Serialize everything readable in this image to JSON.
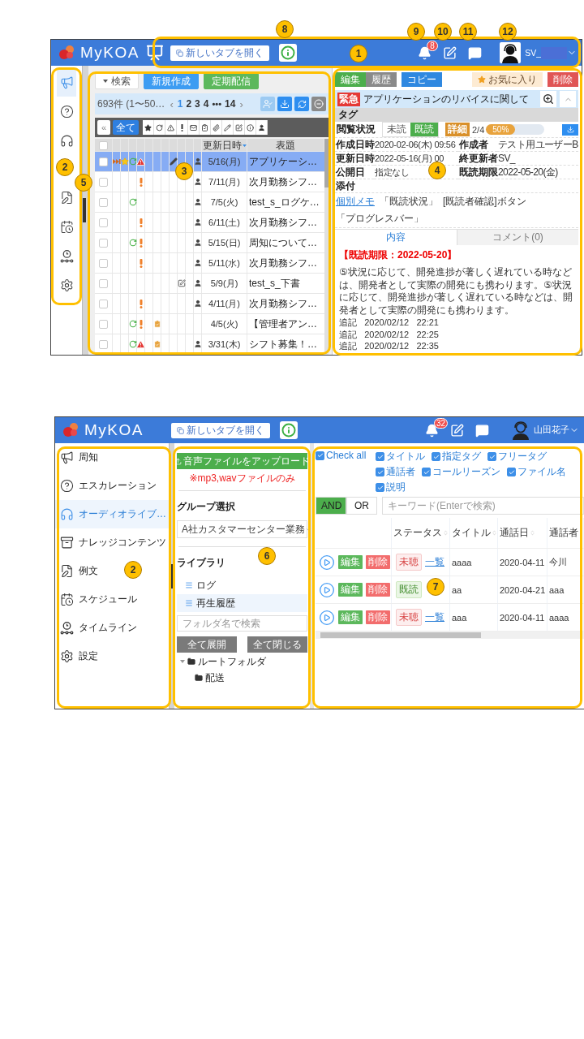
{
  "top_screen": {
    "header": {
      "logo": "MyKOA",
      "new_tab_button": "新しいタブを開く",
      "notification_count": "8",
      "user_name": "SV_"
    },
    "sidebar": [
      {
        "kind": "megaphone",
        "selected": true
      },
      {
        "kind": "question",
        "selected": false
      },
      {
        "kind": "audio",
        "selected": false
      },
      {
        "kind": "document",
        "selected": false
      },
      {
        "kind": "calendar",
        "selected": false
      },
      {
        "kind": "timeline",
        "selected": false
      },
      {
        "kind": "settings",
        "selected": false
      }
    ],
    "toolbar": {
      "search_button": "検索",
      "create_button": "新規作成",
      "schedule_button": "定期配信"
    },
    "pagination": {
      "summary": "693件 (1〜50…",
      "prev": "‹",
      "pages": [
        {
          "label": "1",
          "selected": true
        },
        {
          "label": "2",
          "selected": false
        },
        {
          "label": "3",
          "selected": false
        },
        {
          "label": "4",
          "selected": false
        }
      ],
      "ellipsis": "•••",
      "last_page": {
        "label": "14",
        "selected": false
      },
      "next": "›"
    },
    "filter": {
      "collapse_button": "«",
      "all_button": "全て"
    },
    "table": {
      "header_checked": false,
      "columns": [
        "更新日時",
        "表題"
      ],
      "rows": [
        {
          "selected": true,
          "checked": false,
          "marks": [
            {
              "kind": "forward"
            },
            {
              "kind": "star"
            },
            {
              "kind": "refresh"
            },
            {
              "kind": "warning"
            },
            {
              "kind": "pencil"
            },
            {
              "kind": "person"
            }
          ],
          "date": "5/16(月)",
          "title": "アプリケーシ…"
        },
        {
          "selected": false,
          "checked": false,
          "marks": [
            {
              "kind": "exclaim"
            },
            {
              "kind": "person"
            }
          ],
          "date": "7/11(月)",
          "title": "次月勤務シフ…"
        },
        {
          "selected": false,
          "checked": false,
          "marks": [
            {
              "kind": "refresh"
            },
            {
              "kind": "person"
            }
          ],
          "date": "7/5(火)",
          "title": "test_s_ログケ…"
        },
        {
          "selected": false,
          "checked": false,
          "marks": [
            {
              "kind": "exclaim"
            },
            {
              "kind": "person"
            }
          ],
          "date": "6/11(土)",
          "title": "次月勤務シフ…"
        },
        {
          "selected": false,
          "checked": false,
          "marks": [
            {
              "kind": "refresh"
            },
            {
              "kind": "exclaim"
            },
            {
              "kind": "person"
            }
          ],
          "date": "5/15(日)",
          "title": "周知について…"
        },
        {
          "selected": false,
          "checked": false,
          "marks": [
            {
              "kind": "exclaim"
            },
            {
              "kind": "person"
            }
          ],
          "date": "5/11(水)",
          "title": "次月勤務シフ…"
        },
        {
          "selected": false,
          "checked": false,
          "marks": [
            {
              "kind": "edit"
            },
            {
              "kind": "person"
            }
          ],
          "date": "5/9(月)",
          "title": "test_s_下書"
        },
        {
          "selected": false,
          "checked": false,
          "marks": [
            {
              "kind": "exclaim"
            },
            {
              "kind": "person"
            }
          ],
          "date": "4/11(月)",
          "title": "次月勤務シフ…"
        },
        {
          "selected": false,
          "checked": false,
          "marks": [
            {
              "kind": "refresh"
            },
            {
              "kind": "exclaim"
            },
            {
              "kind": "clipboard"
            }
          ],
          "date": "4/5(火)",
          "title": "【管理者アン…"
        },
        {
          "selected": false,
          "checked": false,
          "marks": [
            {
              "kind": "refresh"
            },
            {
              "kind": "warning"
            },
            {
              "kind": "clipboard"
            },
            {
              "kind": "person"
            }
          ],
          "date": "3/31(木)",
          "title": "シフト募集！…"
        }
      ]
    },
    "detail": {
      "actions": [
        {
          "label": "編集",
          "kind": "edit"
        },
        {
          "label": "履歴",
          "kind": "history"
        },
        {
          "label": "コピー",
          "kind": "copy"
        },
        {
          "label": "お気に入り",
          "kind": "favorite"
        },
        {
          "label": "削除",
          "kind": "delete"
        }
      ],
      "urgent_badge": "緊急",
      "title": "アプリケーションのリバイスに関して",
      "tag_label": "タグ",
      "read_label": "閲覧状況",
      "read_toggle": [
        {
          "label": "未読",
          "selected": false
        },
        {
          "label": "既読",
          "selected": true
        }
      ],
      "detail_badge": "詳細",
      "read_count": "2/4",
      "progress": {
        "level": 0.5,
        "reading": "50%"
      },
      "fields": [
        {
          "label": "作成日時",
          "value": "2020-02-06(木) 09:56"
        },
        {
          "label": "作成者",
          "value": "テスト用ユーザーB"
        },
        {
          "label": "更新日時",
          "value": "2022-05-16(月) 00"
        },
        {
          "label": "終更新者",
          "value": "SV_"
        },
        {
          "label": "公開日",
          "value": "指定なし"
        },
        {
          "label": "既読期限",
          "value": "2022-05-20(金)"
        }
      ],
      "attachment_label": "添付",
      "memo_link": "個別メモ",
      "attachments": [
        "「既読状況」",
        "[既読者確認]ボタン",
        "「プログレスバー」"
      ],
      "tabs": [
        {
          "label": "内容",
          "selected": true
        },
        {
          "label": "コメント(0)",
          "selected": false
        }
      ],
      "deadline": "【既読期限：2022-05-20】",
      "body": "⑤状況に応じて、開発進捗が著しく遅れている時などは、開発者として実際の開発にも携わります。⑤状況に応じて、開発進捗が著しく遅れている時などは、開発者として実際の開発にも携わります。",
      "notes": [
        "追記   2020/02/12   22:21",
        "追記   2020/02/12   22:25",
        "追記   2020/02/12   22:35"
      ]
    },
    "callouts": [
      {
        "number": "8"
      },
      {
        "number": "9"
      },
      {
        "number": "10"
      },
      {
        "number": "11"
      },
      {
        "number": "12"
      },
      {
        "number": "1"
      },
      {
        "number": "2"
      },
      {
        "number": "3"
      },
      {
        "number": "4"
      },
      {
        "number": "5"
      }
    ]
  },
  "bottom_screen": {
    "header": {
      "logo": "MyKOA",
      "new_tab_button": "新しいタブを開く",
      "notification_count": "32",
      "user_name": "山田花子"
    },
    "sidebar": [
      {
        "kind": "megaphone",
        "label": "周知",
        "selected": false
      },
      {
        "kind": "question",
        "label": "エスカレーション",
        "selected": false
      },
      {
        "kind": "audio",
        "label": "オーディオライブ…",
        "selected": true
      },
      {
        "kind": "knowledge",
        "label": "ナレッジコンテンツ",
        "selected": false
      },
      {
        "kind": "document",
        "label": "例文",
        "selected": false
      },
      {
        "kind": "calendar",
        "label": "スケジュール",
        "selected": false
      },
      {
        "kind": "timeline",
        "label": "タイムライン",
        "selected": false
      },
      {
        "kind": "settings",
        "label": "設定",
        "selected": false
      }
    ],
    "library_panel": {
      "upload_button": "音声ファイルをアップロード",
      "upload_note": "※mp3,wavファイルのみ",
      "group_label": "グループ選択",
      "group_select": "A社カスタマーセンター業務",
      "library_label": "ライブラリ",
      "library_items": [
        {
          "label": "ログ",
          "selected": false
        },
        {
          "label": "再生履歴",
          "selected": true
        }
      ],
      "folder_search": {
        "placeholder": "フォルダ名で検索"
      },
      "expand_button": "全て展開",
      "collapse_button": "全て閉じる",
      "tree": [
        {
          "label": "ルートフォルダ",
          "expanded": true,
          "children": [
            {
              "label": "配送"
            }
          ]
        }
      ]
    },
    "audio_panel": {
      "check_all": {
        "label": "Check all",
        "checked": true
      },
      "field_rows": [
        {
          "items": [
            {
              "label": "タイトル",
              "checked": true
            },
            {
              "label": "指定タグ",
              "checked": true
            },
            {
              "label": "フリータグ",
              "checked": true
            }
          ]
        },
        {
          "items": [
            {
              "label": "通話者",
              "checked": true
            },
            {
              "label": "コールリーズン",
              "checked": true
            },
            {
              "label": "ファイル名",
              "checked": true
            },
            {
              "label": "説明",
              "checked": true
            }
          ]
        }
      ],
      "match_mode": [
        {
          "label": "AND",
          "selected": true
        },
        {
          "label": "OR",
          "selected": false
        }
      ],
      "keyword": {
        "placeholder": "キーワード(Enterで検索)"
      },
      "columns": [
        "ステータス",
        "タイトル",
        "通話日",
        "通話者"
      ],
      "rows": [
        {
          "edit": "編集",
          "delete": "削除",
          "status": "未聴",
          "kind": "unheard",
          "link": "一覧",
          "title": "aaaa",
          "date": "2020-04-11",
          "caller": "今川"
        },
        {
          "edit": "編集",
          "delete": "削除",
          "status": "既読",
          "kind": "read",
          "title": "aa",
          "date": "2020-04-21",
          "caller": "aaa"
        },
        {
          "edit": "編集",
          "delete": "削除",
          "status": "未聴",
          "kind": "unheard",
          "link": "一覧",
          "title": "aaa",
          "date": "2020-04-11",
          "caller": "aaaa"
        }
      ]
    },
    "callouts": [
      {
        "number": "2"
      },
      {
        "number": "6"
      },
      {
        "number": "7"
      }
    ]
  }
}
